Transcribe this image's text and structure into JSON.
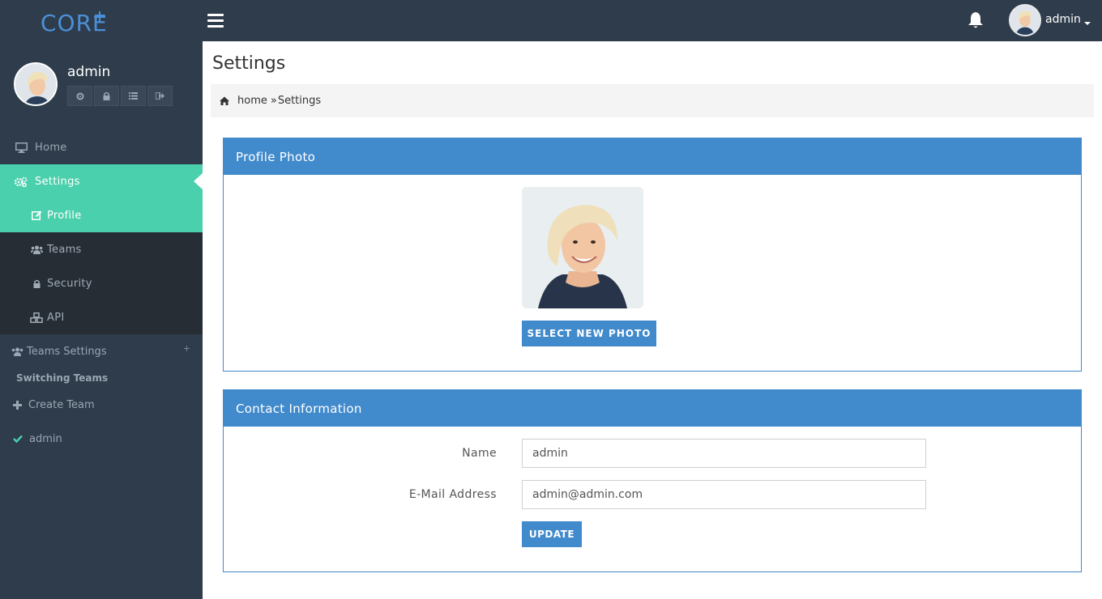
{
  "app": {
    "logo_text": "CORE+",
    "user_name": "admin",
    "top_user_name": "admin"
  },
  "sidebar": {
    "tools": [
      "gear-icon",
      "lock-icon",
      "list-icon",
      "sign-out-icon"
    ],
    "items": [
      {
        "label": "Home",
        "icon": "desktop-icon"
      },
      {
        "label": "Settings",
        "icon": "gears-icon"
      }
    ],
    "sub_items": [
      {
        "label": "Profile",
        "icon": "edit-icon"
      },
      {
        "label": "Teams",
        "icon": "users-icon"
      },
      {
        "label": "Security",
        "icon": "lock-icon"
      },
      {
        "label": "API",
        "icon": "cubes-icon"
      }
    ],
    "teams_settings_label": "Teams Settings",
    "teams_settings_toggle": "+",
    "switching_teams_label": "Switching Teams",
    "create_team_label": "Create Team",
    "current_team_label": "admin"
  },
  "header": {
    "page_title": "Settings",
    "breadcrumb_home": "home",
    "breadcrumb_separator": "»",
    "breadcrumb_current": "Settings"
  },
  "profile_photo": {
    "title": "Profile Photo",
    "button_label": "SELECT NEW PHOTO"
  },
  "contact": {
    "title": "Contact Information",
    "name_label": "Name",
    "name_value": "admin",
    "email_label": "E-Mail Address",
    "email_value": "admin@admin.com",
    "update_label": "UPDATE"
  },
  "colors": {
    "sidebar_bg": "#2f3c4b",
    "accent_green": "#4ad0ac",
    "panel_blue": "#418acb"
  }
}
